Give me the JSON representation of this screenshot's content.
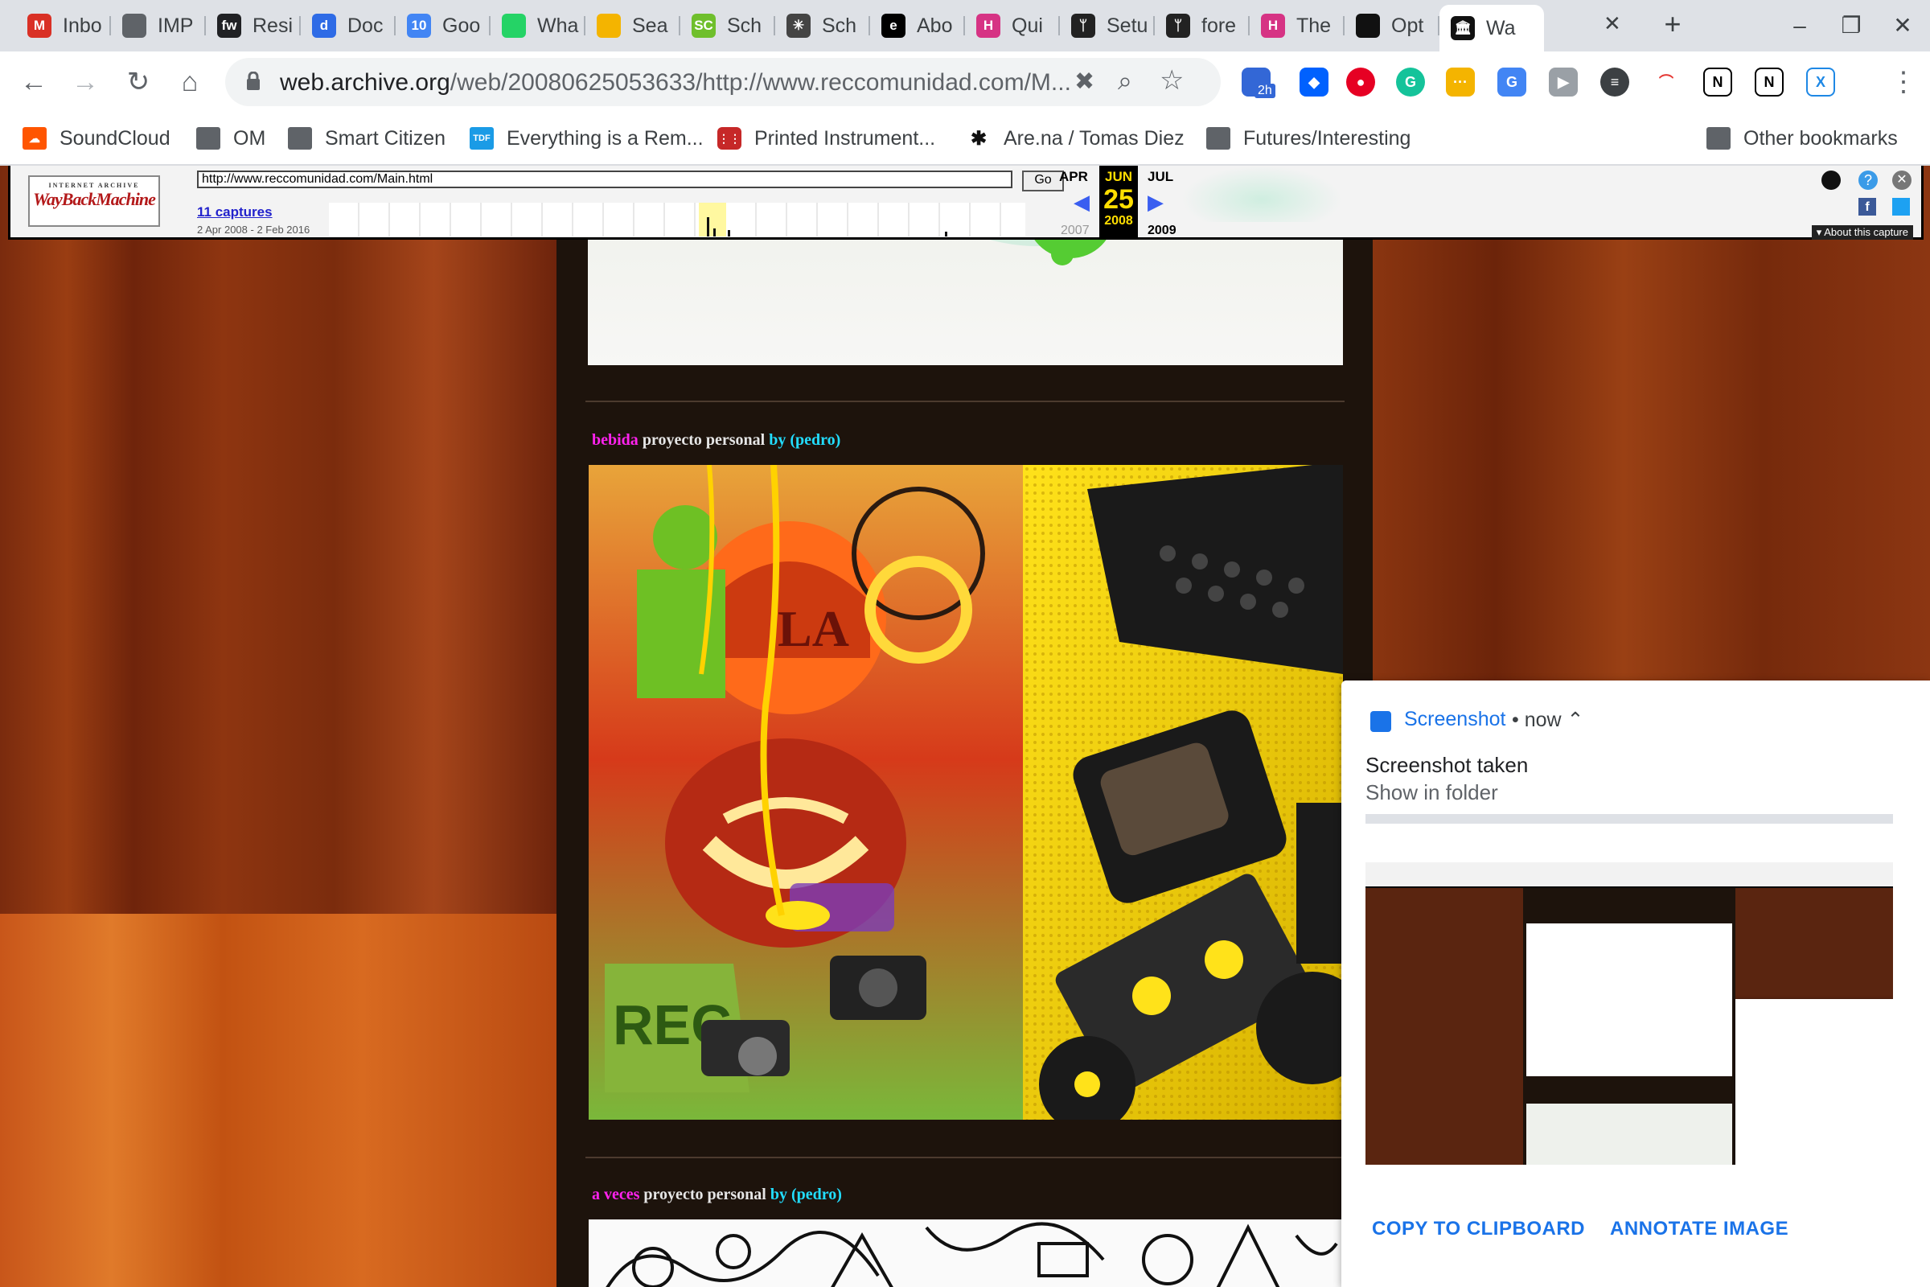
{
  "tabs": [
    {
      "label": "Inbo",
      "icon": "gmail-icon",
      "color": "#d93025",
      "glyph": "M"
    },
    {
      "label": "IMP",
      "icon": "globe-icon",
      "color": "#5f6368",
      "glyph": ""
    },
    {
      "label": "Resi",
      "icon": "fw-icon",
      "color": "#202124",
      "glyph": "fw"
    },
    {
      "label": "Doc",
      "icon": "dropbox-paper-icon",
      "color": "#2e6be6",
      "glyph": "d"
    },
    {
      "label": "Goo",
      "icon": "google-calendar-icon",
      "color": "#4285f4",
      "glyph": "10"
    },
    {
      "label": "Wha",
      "icon": "whatsapp-icon",
      "color": "#25d366",
      "glyph": ""
    },
    {
      "label": "Sea",
      "icon": "google-drive-icon",
      "color": "#f4b400",
      "glyph": ""
    },
    {
      "label": "Sch",
      "icon": "schematic-icon",
      "color": "#6fbf2c",
      "glyph": "SC"
    },
    {
      "label": "Sch",
      "icon": "asterisk-icon",
      "color": "#444",
      "glyph": "✳"
    },
    {
      "label": "Abo",
      "icon": "e-icon",
      "color": "#000",
      "glyph": "e"
    },
    {
      "label": "Qui",
      "icon": "hackmd-icon",
      "color": "#d63384",
      "glyph": "H"
    },
    {
      "label": "Setu",
      "icon": "antenna-icon",
      "color": "#222",
      "glyph": "ᛘ"
    },
    {
      "label": "fore",
      "icon": "antenna-icon",
      "color": "#222",
      "glyph": "ᛘ"
    },
    {
      "label": "The",
      "icon": "hackmd-icon",
      "color": "#d63384",
      "glyph": "H"
    },
    {
      "label": "Opt",
      "icon": "github-icon",
      "color": "#111",
      "glyph": ""
    },
    {
      "label": "Wa",
      "icon": "internet-archive-icon",
      "color": "#111",
      "glyph": "🏛"
    }
  ],
  "toolbar": {
    "url_host": "web.archive.org",
    "url_rest": "/web/20080625053633/http://www.reccomunidad.com/M...",
    "ext_badge": "2h"
  },
  "bookmarks": [
    {
      "label": "SoundCloud"
    },
    {
      "label": "OM"
    },
    {
      "label": "Smart Citizen"
    },
    {
      "label": "Everything is a Rem..."
    },
    {
      "label": "Printed Instrument..."
    },
    {
      "label": "Are.na / Tomas Diez"
    },
    {
      "label": "Futures/Interesting"
    }
  ],
  "bookmarks_other": "Other bookmarks",
  "wayback": {
    "logo_top": "INTERNET ARCHIVE",
    "logo_main": "WayBackMachine",
    "url_value": "http://www.reccomunidad.com/Main.html",
    "go": "Go",
    "captures": "11 captures",
    "range": "2 Apr 2008 - 2 Feb 2016",
    "month_prev": "APR",
    "month_cur": "JUN",
    "month_next": "JUL",
    "day": "25",
    "year_prev": "2007",
    "year_cur": "2008",
    "year_next": "2009",
    "about": "About this capture"
  },
  "posts": [
    {
      "word": "bebida",
      "rest": " proyecto personal ",
      "by": "by (pedro)"
    },
    {
      "word": "a veces",
      "rest": " proyecto personal ",
      "by": "by (pedro)"
    }
  ],
  "notification": {
    "app": "Screenshot",
    "time": "• now ⌃",
    "title": "Screenshot taken",
    "subtitle": "Show in folder",
    "copy": "COPY TO CLIPBOARD",
    "annotate": "ANNOTATE IMAGE"
  },
  "colors": {
    "accent": "#1a73e8",
    "title_magenta": "#ff22ee",
    "title_cyan": "#22ddff"
  }
}
